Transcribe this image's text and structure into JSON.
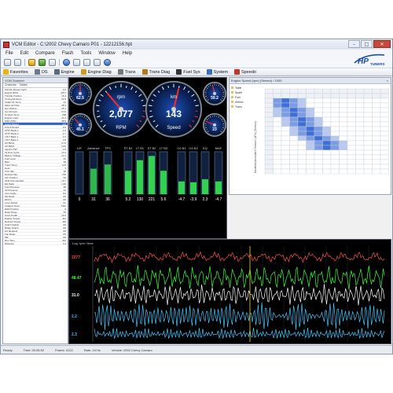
{
  "window": {
    "title": "VCM Editor - C:\\2002 Chevy Camaro P01 - 12212156.hpt",
    "buttons": {
      "minimize": "–",
      "maximize": "□",
      "close": "✕"
    }
  },
  "menu": [
    "File",
    "Edit",
    "Compare",
    "Flash",
    "Tools",
    "Window",
    "Help"
  ],
  "logo": {
    "text": "HP",
    "subtext": "TUNERS"
  },
  "nav": [
    {
      "label": "Favorites",
      "icon": "star-icon",
      "color": "#e6b417"
    },
    {
      "label": "OS",
      "icon": "chip-icon",
      "color": "#6c7a8c"
    },
    {
      "label": "Engine",
      "icon": "engine-icon",
      "color": "#5b6a7d"
    },
    {
      "label": "Engine Diag",
      "icon": "engine-diag-icon",
      "color": "#d09a20"
    },
    {
      "label": "Trans",
      "icon": "gear-icon",
      "color": "#777777"
    },
    {
      "label": "Trans Diag",
      "icon": "gear-diag-icon",
      "color": "#b07a20"
    },
    {
      "label": "Fuel Sys",
      "icon": "fuel-icon",
      "color": "#333333"
    },
    {
      "label": "System",
      "icon": "system-icon",
      "color": "#3b6fc0"
    },
    {
      "label": "Speedo",
      "icon": "speedo-icon",
      "color": "#c03a2b"
    }
  ],
  "left_panel": {
    "header": "VCM Scanner",
    "tabs": [
      "Channels",
      "Tables"
    ],
    "rows": [
      {
        "name": "Vehicle Speed (mph)",
        "value": "0.0"
      },
      {
        "name": "Engine RPM",
        "value": "2077"
      },
      {
        "name": "Throttle Position",
        "value": "16.3"
      },
      {
        "name": "Timing Advance",
        "value": "22.5"
      },
      {
        "name": "Intake Air Temp",
        "value": "91"
      },
      {
        "name": "Mass Air Flow",
        "value": "48.3"
      },
      {
        "name": "Dyn Airflow",
        "value": "45.1"
      },
      {
        "name": "Cyl Airmass",
        "value": "0.31"
      },
      {
        "name": "Coolant Temp",
        "value": "188"
      },
      {
        "name": "Engine Load",
        "value": "41.2"
      },
      {
        "name": "MAP (kPa)",
        "value": "48.5"
      },
      {
        "name": "Spark Retard",
        "value": "0.0"
      },
      {
        "name": "Knock Retard",
        "value": "0.0"
      },
      {
        "name": "STFT Bank 1",
        "value": "-2.3"
      },
      {
        "name": "STFT Bank 2",
        "value": "-4.7"
      },
      {
        "name": "LTFT Bank 1",
        "value": "1.6"
      },
      {
        "name": "LTFT Bank 2",
        "value": "0.8"
      },
      {
        "name": "O2 B1S1",
        "value": "0.74"
      },
      {
        "name": "O2 B2S1",
        "value": "0.81"
      },
      {
        "name": "Injector PW",
        "value": "3.9"
      },
      {
        "name": "Inj Duty Cycle",
        "value": "12.4"
      },
      {
        "name": "Battery Voltage",
        "value": "14.1"
      },
      {
        "name": "Fuel Level",
        "value": "62"
      },
      {
        "name": "Baro",
        "value": "99"
      },
      {
        "name": "Trans Temp",
        "value": "143"
      },
      {
        "name": "Gear",
        "value": "3"
      },
      {
        "name": "TCC Slip",
        "value": "38"
      },
      {
        "name": "Desired Idle",
        "value": "700"
      },
      {
        "name": "IAC Position",
        "value": "52"
      },
      {
        "name": "AFR Commanded",
        "value": "14.7"
      },
      {
        "name": "EQ Ratio",
        "value": "1.00"
      },
      {
        "name": "Fuel Pressure",
        "value": "58"
      },
      {
        "name": "Oil Pressure",
        "value": "42"
      },
      {
        "name": "Cam Angle",
        "value": "0.0"
      },
      {
        "name": "PE Mode",
        "value": "Off"
      },
      {
        "name": "DFCO",
        "value": "Off"
      },
      {
        "name": "Loop Status",
        "value": "CL"
      },
      {
        "name": "Catalyst Temp",
        "value": "1112"
      },
      {
        "name": "EGR Position",
        "value": "0"
      },
      {
        "name": "Evap Purge",
        "value": "22"
      },
      {
        "name": "Accel Pedal",
        "value": "16.0"
      },
      {
        "name": "Engine Torque",
        "value": "112"
      },
      {
        "name": "Desired Torque",
        "value": "110"
      },
      {
        "name": "Clutch Switch",
        "value": "Off"
      },
      {
        "name": "Brake Switch",
        "value": "Off"
      },
      {
        "name": "AC Request",
        "value": "Off"
      },
      {
        "name": "Fan Relay",
        "value": "Off"
      },
      {
        "name": "MIL",
        "value": "Off"
      },
      {
        "name": "Run Time",
        "value": "412"
      },
      {
        "name": "Distance",
        "value": "3.4"
      }
    ]
  },
  "gauges": {
    "rpm": {
      "label": "rpm",
      "value": "2,077",
      "caption": "RPM",
      "fraction": 0.35
    },
    "speed": {
      "label": "km",
      "value": "143",
      "caption": "Speed",
      "fraction": 0.55
    },
    "small": [
      {
        "value": "62.5",
        "fraction": 0.5
      },
      {
        "value": "45.1",
        "fraction": 0.35
      },
      {
        "value": "59.2",
        "fraction": 0.45
      },
      {
        "value": "23",
        "fraction": 0.25
      }
    ],
    "bars": [
      {
        "label": "KR",
        "value": "0",
        "fraction": 0.0
      },
      {
        "label": "Advance",
        "value": "31",
        "fraction": 0.6
      },
      {
        "label": "TPS",
        "value": "36",
        "fraction": 0.7
      },
      {
        "label": "ST B1",
        "value": "5.2",
        "fraction": 0.55
      },
      {
        "label": "LT B1",
        "value": "130",
        "fraction": 0.8
      },
      {
        "label": "ST B2",
        "value": "221",
        "fraction": 0.9
      },
      {
        "label": "LT B2",
        "value": "5.6",
        "fraction": 0.55
      },
      {
        "label": "O2 B1",
        "value": "-4.7",
        "fraction": 0.3
      },
      {
        "label": "O2 B2",
        "value": "-3.9",
        "fraction": 0.28
      },
      {
        "label": "EQ",
        "value": "2.3",
        "fraction": 0.35
      },
      {
        "label": "MAF",
        "value": "-4.7",
        "fraction": 0.3
      }
    ]
  },
  "table": {
    "title": "Engine Speed (rpm) (Sensor) / 1000",
    "tree": [
      "Table",
      "Spark",
      "Fuel",
      "Airflow",
      "Trans"
    ],
    "y_axis_label": "Manifold Absolute Pressure (kPa) (Sensor)"
  },
  "log": {
    "header": "Log: rpm / time",
    "channels": [
      {
        "value": "2077",
        "color": "#ff4040"
      },
      {
        "value": "48.47",
        "color": "#40ff40"
      },
      {
        "value": "31.0",
        "color": "#ffffff"
      },
      {
        "value": "2.2",
        "color": "#40c0ff"
      },
      {
        "value": "2.3",
        "color": "#40c0ff"
      }
    ]
  },
  "status": [
    "Ready",
    "Time: 00:06:52",
    "Frame: 4122",
    "Rate: 24 Hz",
    "Vehicle: 2002 Chevy Camaro"
  ]
}
